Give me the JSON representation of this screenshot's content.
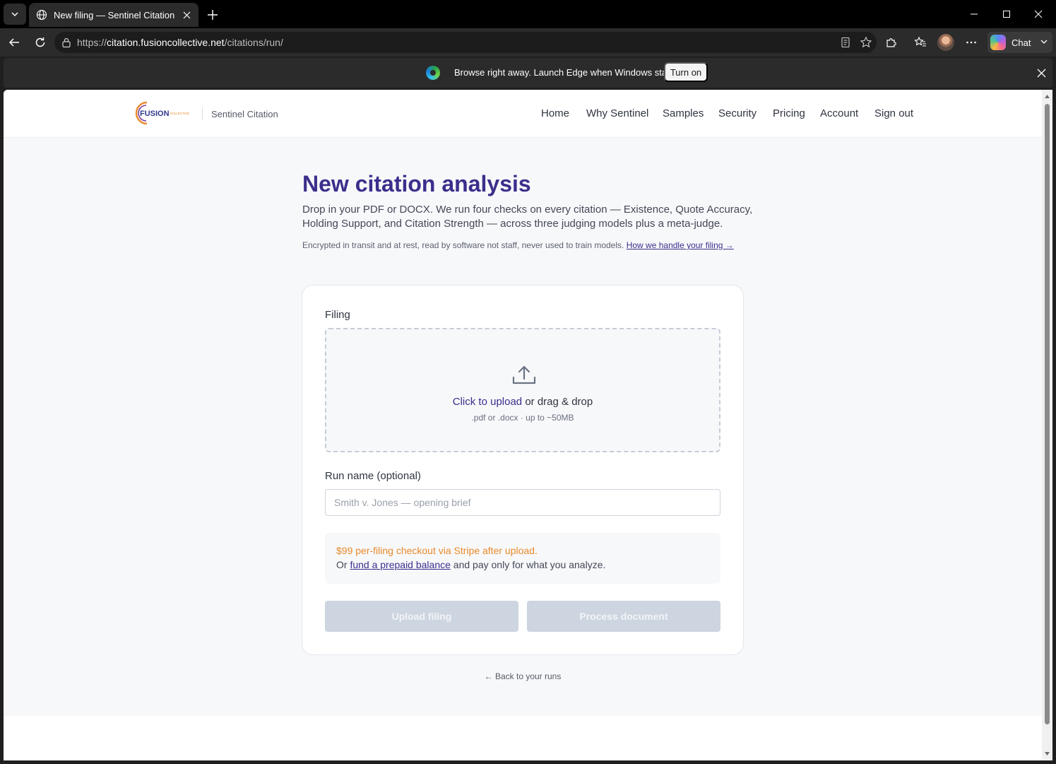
{
  "browser": {
    "tab_title": "New filing — Sentinel Citation",
    "url_scheme": "https://",
    "url_host": "citation.fusioncollective.net",
    "url_path": "/citations/run/",
    "chat_label": "Chat",
    "infobar_text": "Browse right away. Launch Edge when Windows starts.",
    "infobar_button": "Turn on"
  },
  "site": {
    "logo_text": "FUSION",
    "logo_sub": "COLLECTIVE",
    "product_name": "Sentinel Citation",
    "nav": [
      "Home",
      "Why Sentinel",
      "Samples",
      "Security",
      "Pricing",
      "Account",
      "Sign out"
    ]
  },
  "page": {
    "title": "New citation analysis",
    "lead": "Drop in your PDF or DOCX. We run four checks on every citation — Existence, Quote Accuracy, Holding Support, and Citation Strength — across three judging models plus a meta-judge.",
    "note": "Encrypted in transit and at rest, read by software not staff, never used to train models.",
    "note_link": "How we handle your filing →"
  },
  "form": {
    "filing_label": "Filing",
    "upload_link": "Click to upload",
    "upload_rest": " or drag & drop",
    "upload_hint": ".pdf or .docx · up to ~50MB",
    "run_name_label": "Run name (optional)",
    "run_name_value": "",
    "run_name_placeholder": "Smith v. Jones — opening brief",
    "price_text": "$99 per-filing checkout via Stripe after upload.",
    "alt_prefix": "Or ",
    "alt_link": "fund a prepaid balance",
    "alt_suffix": " and pay only for what you analyze.",
    "upload_button": "Upload filing",
    "process_button": "Process document"
  },
  "footer": {
    "back_link": "← Back to your runs"
  },
  "colors": {
    "brand": "#3b2f8c",
    "price_accent": "#e88a2a",
    "disabled_button": "#cdd5e0"
  }
}
